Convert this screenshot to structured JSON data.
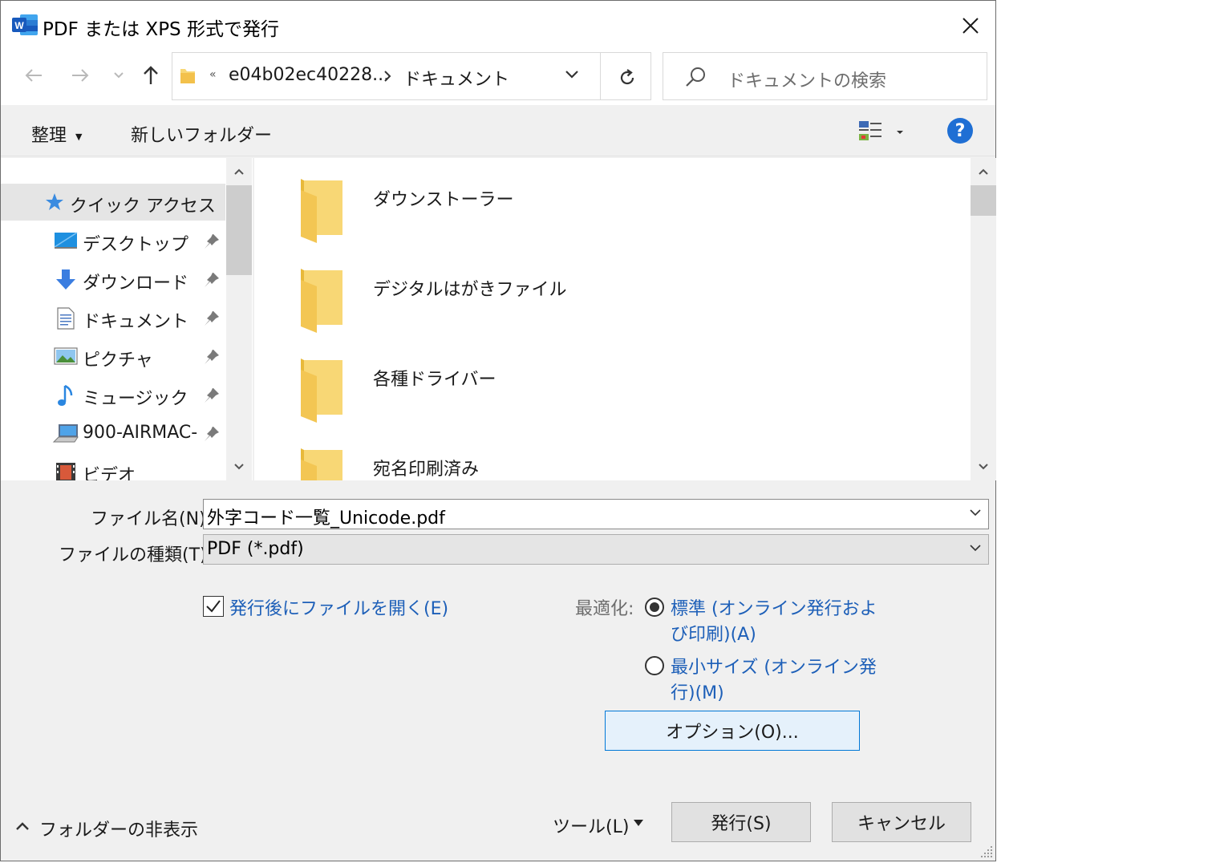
{
  "window": {
    "title": "PDF または XPS 形式で発行",
    "app_icon": "word-icon"
  },
  "address_bar": {
    "overflow_chevron": "«",
    "segments": [
      "e04b02ec40228...",
      "ドキュメント"
    ]
  },
  "search": {
    "placeholder": "ドキュメントの検索"
  },
  "toolbar": {
    "organize_label": "整理",
    "new_folder_label": "新しいフォルダー"
  },
  "nav_pane": {
    "items": [
      {
        "label": "クイック アクセス",
        "icon": "star-icon",
        "selected": true
      },
      {
        "label": "デスクトップ",
        "icon": "desktop-icon",
        "pinned": true
      },
      {
        "label": "ダウンロード",
        "icon": "download-icon",
        "pinned": true
      },
      {
        "label": "ドキュメント",
        "icon": "document-icon",
        "pinned": true
      },
      {
        "label": "ピクチャ",
        "icon": "pictures-icon",
        "pinned": true
      },
      {
        "label": "ミュージック",
        "icon": "music-icon",
        "pinned": true
      },
      {
        "label": "900-AIRMAC-",
        "icon": "computer-icon",
        "pinned": true
      },
      {
        "label": "ビデオ",
        "icon": "video-icon",
        "pinned": false
      }
    ]
  },
  "files": [
    {
      "name": "ダウンストーラー",
      "icon": "folder-icon"
    },
    {
      "name": "デジタルはがきファイル",
      "icon": "folder-icon"
    },
    {
      "name": "各種ドライバー",
      "icon": "folder-icon"
    },
    {
      "name": "宛名印刷済み",
      "icon": "folder-icon"
    }
  ],
  "form": {
    "filename_label": "ファイル名(N):",
    "filename_value": "外字コード一覧_Unicode.pdf",
    "filetype_label": "ファイルの種類(T):",
    "filetype_value": "PDF (*.pdf)",
    "open_after_label": "発行後にファイルを開く(E)",
    "open_after_checked": true,
    "optimize_label": "最適化:",
    "opt_standard_line1": "標準 (オンライン発行およ",
    "opt_standard_line2": "び印刷)(A)",
    "opt_minimum_line1": "最小サイズ (オンライン発",
    "opt_minimum_line2": "行)(M)",
    "options_button": "オプション(O)..."
  },
  "footer": {
    "hide_folders": "フォルダーの非表示",
    "tools": "ツール(L)",
    "publish": "発行(S)",
    "cancel": "キャンセル"
  },
  "colors": {
    "accent_link": "#1d5fb8",
    "help_icon": "#1f6fd4",
    "folder": "#f8d775"
  }
}
